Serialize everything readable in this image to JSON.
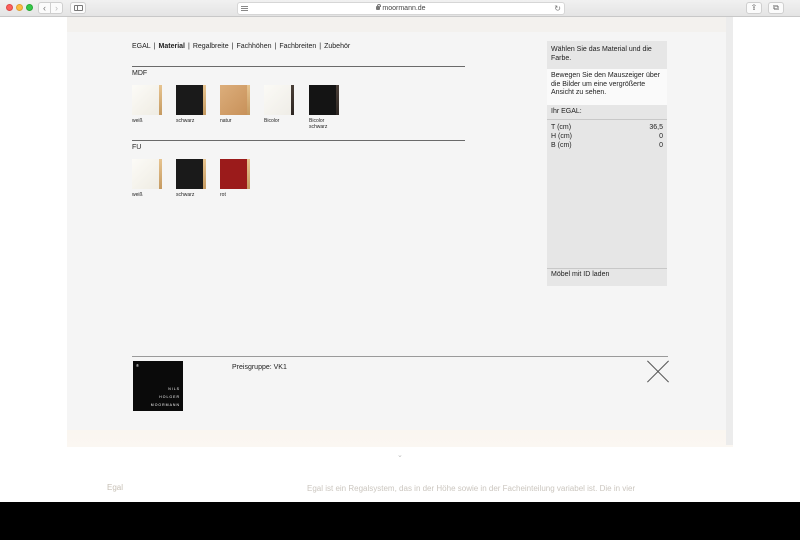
{
  "browser": {
    "url": "moormann.de",
    "back_glyph": "‹",
    "forward_glyph": "›",
    "reload_glyph": "↻",
    "share_glyph": "⇪",
    "tabs_glyph": "⧉",
    "new_tab_glyph": "+"
  },
  "breadcrumb": {
    "items": [
      "EGAL",
      "Material",
      "Regalbreite",
      "Fachhöhen",
      "Fachbreiten",
      "Zubehör"
    ],
    "separator": "|"
  },
  "sections": [
    {
      "label": "MDF",
      "swatches": [
        {
          "label": "weiß",
          "icon": "white-board"
        },
        {
          "label": "schwarz",
          "icon": "black-board"
        },
        {
          "label": "natur",
          "icon": "natural-board"
        },
        {
          "label": "Bicolor",
          "icon": "bicolor-board"
        },
        {
          "label": "Bicolor schwarz",
          "icon": "bicolor-black-board"
        }
      ]
    },
    {
      "label": "FU",
      "swatches": [
        {
          "label": "weiß",
          "icon": "white-board"
        },
        {
          "label": "schwarz",
          "icon": "black-board"
        },
        {
          "label": "rot",
          "icon": "red-board"
        }
      ]
    }
  ],
  "info": {
    "title": "Wählen Sie das Material und die Farbe.",
    "hint": "Bewegen Sie den Mauszeiger über die Bilder um eine vergrößerte Ansicht zu sehen.",
    "yours": "Ihr EGAL:",
    "dimensions": [
      {
        "label": "T (cm)",
        "value": "36,5"
      },
      {
        "label": "H (cm)",
        "value": "0"
      },
      {
        "label": "B (cm)",
        "value": "0"
      }
    ],
    "load_id": "Möbel mit ID laden"
  },
  "footer": {
    "logo_mark": "®",
    "logo_lines": [
      "NILS",
      "HOLGER",
      "MOORMANN"
    ],
    "price": "Preisgruppe: VK1"
  },
  "background": {
    "left_label": "Egal",
    "right_text": "Egal ist ein Regalsystem, das in der Höhe sowie in der Facheinteilung variabel ist. Die in vier"
  },
  "colors": {
    "accent_red": "#9b1b1b",
    "panel_gray": "#e6e6e6"
  }
}
